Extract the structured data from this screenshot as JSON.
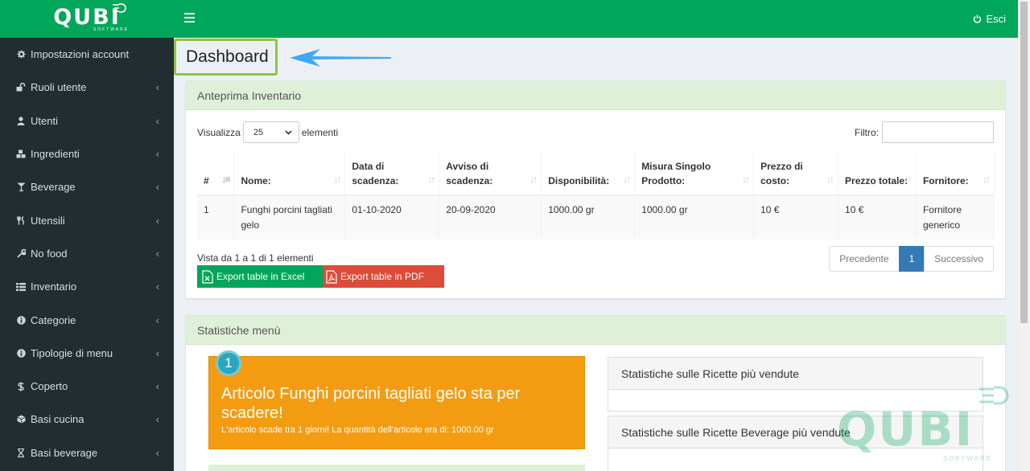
{
  "brand": {
    "name": "QUBI",
    "sub": "SOFTWARE"
  },
  "sidebar": {
    "items": [
      {
        "label": "Impostazioni account",
        "icon": "gear-icon",
        "chevron": false
      },
      {
        "label": "Ruoli utente",
        "icon": "unlock-icon",
        "chevron": true
      },
      {
        "label": "Utenti",
        "icon": "user-icon",
        "chevron": true
      },
      {
        "label": "Ingredienti",
        "icon": "cubes-icon",
        "chevron": true
      },
      {
        "label": "Beverage",
        "icon": "cocktail-glass-icon",
        "chevron": true
      },
      {
        "label": "Utensili",
        "icon": "utensils-icon",
        "chevron": true
      },
      {
        "label": "No food",
        "icon": "wrench-icon",
        "chevron": true
      },
      {
        "label": "Inventario",
        "icon": "list-icon",
        "chevron": true
      },
      {
        "label": "Categorie",
        "icon": "info-circle-icon",
        "chevron": true
      },
      {
        "label": "Tipologie di menu",
        "icon": "info-circle-icon",
        "chevron": true
      },
      {
        "label": "Coperto",
        "icon": "dollar-icon",
        "chevron": true
      },
      {
        "label": "Basi cucina",
        "icon": "cube-icon",
        "chevron": true
      },
      {
        "label": "Basi beverage",
        "icon": "hourglass-icon",
        "chevron": true
      }
    ]
  },
  "topbar": {
    "logout_label": "Esci"
  },
  "page": {
    "title": "Dashboard"
  },
  "inventory": {
    "title": "Anteprima Inventario",
    "show_label": "Visualizza",
    "show_value": "25",
    "entries_label": "elementi",
    "filter_label": "Filtro:",
    "columns": [
      "#",
      "Nome:",
      "Data di scadenza:",
      "Avviso di scadenza:",
      "Disponibilità:",
      "Misura Singolo Prodotto:",
      "Prezzo di costo:",
      "Prezzo totale:",
      "Fornitore:"
    ],
    "rows": [
      [
        "1",
        "Funghi porcini tagliati gelo",
        "01-10-2020",
        "20-09-2020",
        "1000.00 gr",
        "1000.00 gr",
        "10 €",
        "10 €",
        "Fornitore generico"
      ]
    ],
    "info": "Vista da 1 a 1 di 1 elementi",
    "export_excel": "Export table in Excel",
    "export_pdf": "Export table in PDF",
    "pager": {
      "prev": "Precedente",
      "current": "1",
      "next": "Successivo"
    }
  },
  "stats": {
    "title": "Statistiche menù",
    "alert": {
      "badge": "1",
      "title": "Articolo Funghi porcini tagliati gelo sta per scadere!",
      "text": "L'articolo scade tra 1 giorni! La quantità dell'articolo era di: 1000.00 gr"
    },
    "panel1": "Statistiche sulle Ricette più vendute",
    "panel2": "Statistiche sulle Ricette Beverage più vendute"
  },
  "colors": {
    "primary": "#00a65a",
    "sidebar": "#222d32",
    "warning": "#f39c12",
    "danger": "#dd4b39",
    "header_bg": "#dff0d8",
    "highlight": "#8dc63f",
    "arrow": "#3fa9f5"
  }
}
